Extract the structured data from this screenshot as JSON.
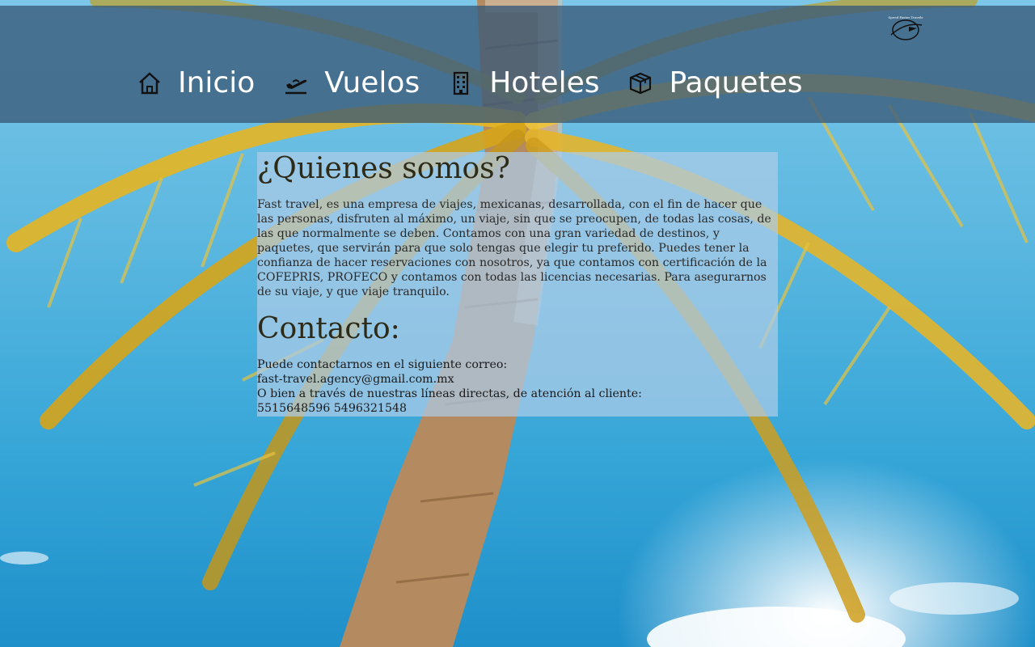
{
  "logo": {
    "text": "Speed Faster Travels",
    "icon": "airplane-globe-icon"
  },
  "nav": {
    "items": [
      {
        "label": "Inicio",
        "icon": "home-icon"
      },
      {
        "label": "Vuelos",
        "icon": "plane-departure-icon"
      },
      {
        "label": "Hoteles",
        "icon": "building-icon"
      },
      {
        "label": "Paquetes",
        "icon": "package-icon"
      }
    ]
  },
  "about": {
    "title": "¿Quienes somos?",
    "body": "Fast travel, es una empresa de viajes, mexicanas, desarrollada, con el fin de hacer que las personas, disfruten al máximo, un viaje, sin que se preocupen, de todas las cosas, de las que normalmente se deben. Contamos con una gran variedad de destinos, y paquetes, que servirán para que solo tengas que elegir tu preferido. Puedes tener la confianza de hacer reservaciones con nosotros, ya que contamos con certificación de la COFEPRIS, PROFECO y contamos con todas las licencias necesarias. Para asegurarnos de su viaje, y que viaje tranquilo."
  },
  "contact": {
    "title": "Contacto:",
    "line1": "Puede contactarnos en el siguiente correo:",
    "email": "fast-travel.agency@gmail.com.mx",
    "line2": "O bien a través de nuestras líneas directas, de atención al cliente:",
    "phones": "5515648596 5496321548"
  },
  "colors": {
    "nav_bar": "#3a5a78",
    "panel": "#adcce8",
    "sky": "#36a6d8"
  }
}
